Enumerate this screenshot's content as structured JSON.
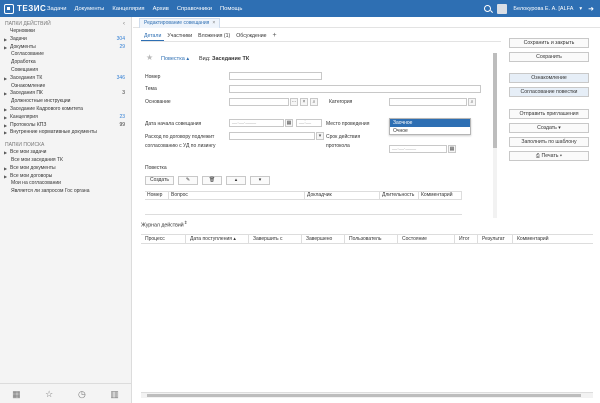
{
  "topbar": {
    "logo": "ТЕЗИС",
    "menu": [
      "Задачи",
      "Документы",
      "Канцелярия",
      "Архив",
      "Справочники",
      "Помощь"
    ],
    "user": "Белокурова Е. А. [ALFA",
    "user_caret": "▾"
  },
  "sidebar": {
    "actions_header": "ПАПКИ ДЕЙСТВИЙ",
    "collapse": "‹",
    "actions": [
      {
        "label": "Черновики",
        "count": "",
        "level": 0,
        "expand": false
      },
      {
        "label": "Задачи",
        "count": "304",
        "level": 0,
        "expand": true,
        "count_color": "blue"
      },
      {
        "label": "Документы",
        "count": "29",
        "level": 0,
        "expand": true,
        "count_color": "blue"
      },
      {
        "label": "Согласование",
        "count": "",
        "level": 1,
        "expand": false
      },
      {
        "label": "Доработка",
        "count": "",
        "level": 1,
        "expand": false
      },
      {
        "label": "Совещания",
        "count": "",
        "level": 1,
        "expand": false
      },
      {
        "label": "Заседания ТК",
        "count": "346",
        "level": 0,
        "expand": true,
        "count_color": "blue"
      },
      {
        "label": "Ознакомление",
        "count": "",
        "level": 1,
        "expand": false
      },
      {
        "label": "Заседания ПК",
        "count": "3",
        "level": 0,
        "expand": true,
        "count_color": "dark"
      },
      {
        "label": "Должностные инструкции",
        "count": "",
        "level": 1,
        "expand": false
      },
      {
        "label": "Заседание Кадрового комитета",
        "count": "",
        "level": 0,
        "expand": true
      },
      {
        "label": "Канцелярия",
        "count": "23",
        "level": 0,
        "expand": true,
        "count_color": "blue"
      },
      {
        "label": "Протоколы КПЗ",
        "count": "99",
        "level": 0,
        "expand": true,
        "count_color": "dark"
      },
      {
        "label": "Внутренние нормативные документы",
        "count": "",
        "level": 0,
        "expand": true
      }
    ],
    "search_header": "ПАПКИ ПОИСКА",
    "search": [
      {
        "label": "Все мои задачи",
        "level": 0,
        "expand": true
      },
      {
        "label": "Все мои заседания ТК",
        "level": 1,
        "expand": false
      },
      {
        "label": "Все мои документы",
        "level": 0,
        "expand": true
      },
      {
        "label": "Все мои договоры",
        "level": 0,
        "expand": true
      },
      {
        "label": "Мои на согласовании",
        "level": 1,
        "expand": false
      },
      {
        "label": "Является ли запросом Гос органа",
        "level": 1,
        "expand": false
      }
    ]
  },
  "doc_tab": {
    "label": "Редактирование совещания",
    "close": "×"
  },
  "subtabs": [
    "Детали",
    "Участники",
    "Вложения (1)",
    "Обсуждение",
    "+"
  ],
  "header": {
    "povestka_link": "Повестка ▴",
    "vid_label": "Вид:",
    "vid_value": "Заседание ТК"
  },
  "form": {
    "nomer": "Номер",
    "tema": "Тема",
    "osnovanie": "Основание",
    "kategoriya": "Категория",
    "data_nachala": "Дата начала совещания",
    "mesto": "Место проведения",
    "rashod": "Расход по договору подлежит согласованию с УД по лизингу",
    "srok": "Срок действия протокола",
    "date_mask": "__.__.____",
    "time_mask": "__:__",
    "clear": "×",
    "more": "···"
  },
  "category_dropdown": [
    "Заочное",
    "Очное"
  ],
  "agenda": {
    "title": "Повестка",
    "create_btn": "Создать",
    "edit_icon": "✎",
    "delete_icon": "🗑",
    "up_icon": "▴",
    "down_icon": "▾",
    "columns": [
      "Номер",
      "Вопрос",
      "Докладчик",
      "Длительность",
      "Комментарий"
    ]
  },
  "actions": {
    "save_close": "Сохранить и закрыть",
    "save": "Сохранить",
    "familiarize": "Ознакомление",
    "agree_agenda": "Согласование повестки",
    "send_invites": "Отправить приглашения",
    "create": "Создать",
    "fill_template": "Заполнить по шаблону",
    "print": "Печать"
  },
  "journal": {
    "title": "Журнал действий",
    "columns": [
      "Процесс",
      "Дата поступления",
      "Завершить с",
      "Завершено",
      "Пользователь",
      "Состояние",
      "Итог",
      "Результат",
      "Комментарий"
    ]
  },
  "bottom_icons": [
    "calendar-icon",
    "star-icon",
    "clock-icon",
    "chart-icon"
  ]
}
